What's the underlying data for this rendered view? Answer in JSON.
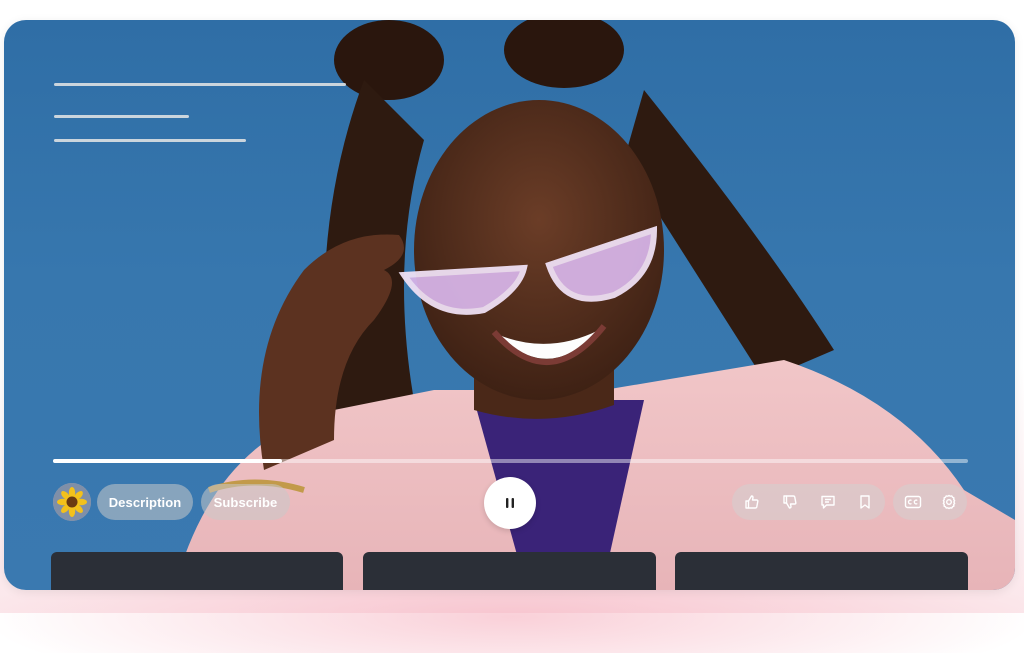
{
  "player": {
    "progress_fraction": 0.25,
    "description_label": "Description",
    "subscribe_label": "Subscribe"
  },
  "icons": {
    "channel_avatar": "sunflower-avatar",
    "play_state": "pause-icon",
    "actions": [
      "thumbs-up-icon",
      "thumbs-down-icon",
      "comment-icon",
      "bookmark-icon"
    ],
    "settings": [
      "closed-captions-icon",
      "gear-icon"
    ]
  },
  "colors": {
    "sky": "#3777ae",
    "control_pill": "#c8c8c8",
    "thumbnail": "#2b2f37"
  }
}
